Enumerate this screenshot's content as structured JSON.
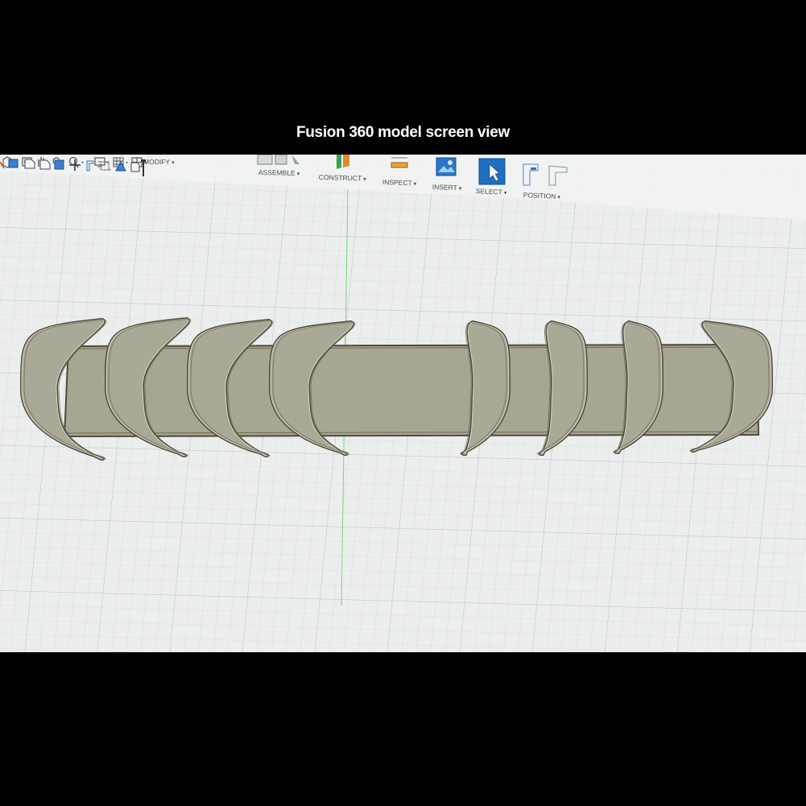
{
  "caption": "Fusion 360 model screen view",
  "toolbar": {
    "modify": "MODIFY",
    "assemble": "ASSEMBLE",
    "construct": "CONSTRUCT",
    "inspect": "INSPECT",
    "insert": "INSERT",
    "select": "SELECT",
    "position": "POSITION",
    "caret": "▾"
  },
  "colors": {
    "canvas": "#eef0f0",
    "grid": "#c9cfd0",
    "grid_major": "#b5bcbd",
    "model_fill": "#a9a795",
    "model_edge": "#55533f",
    "select_blue": "#1f6fc2",
    "axis_green": "#6ccf6c"
  },
  "icons": {
    "nav": [
      "orbit-icon",
      "look-at-icon",
      "pan-icon",
      "zoom-window-icon",
      "zoom-icon",
      "display-settings-icon",
      "grid-settings-icon",
      "viewports-icon"
    ],
    "timeline": [
      "timeline-body-icon",
      "timeline-sketch-icon",
      "timeline-extrude-icon",
      "timeline-extrude-icon",
      "timeline-component-icon",
      "timeline-move-icon",
      "timeline-plane-icon",
      "timeline-joint-icon",
      "timeline-construct-icon",
      "timeline-sketch-icon",
      "timeline-marker-icon"
    ]
  }
}
